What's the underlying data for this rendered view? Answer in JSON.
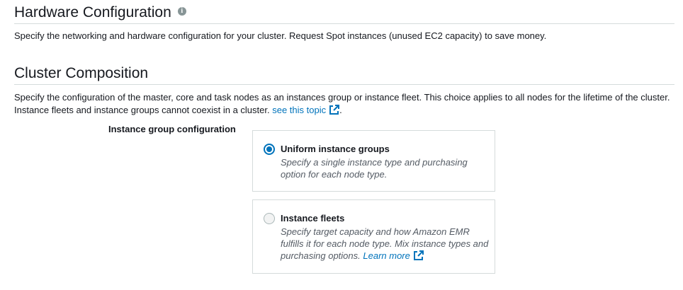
{
  "hardware": {
    "title": "Hardware Configuration",
    "info_icon": "info-icon",
    "description": "Specify the networking and hardware configuration for your cluster. Request Spot instances (unused EC2 capacity) to save money."
  },
  "composition": {
    "title": "Cluster Composition",
    "description": "Specify the configuration of the master, core and task nodes as an instances group or instance fleet. This choice applies to all nodes for the lifetime of the cluster. Instance fleets and instance groups cannot coexist in a cluster.",
    "link_text": "see this topic",
    "link_icon": "external-link-icon",
    "trailing": "."
  },
  "instance_config": {
    "label": "Instance group configuration",
    "selected": "uniform",
    "options": [
      {
        "id": "uniform",
        "title": "Uniform instance groups",
        "description": "Specify a single instance type and purchasing option for each node type."
      },
      {
        "id": "fleets",
        "title": "Instance fleets",
        "description": "Specify target capacity and how Amazon EMR fulfills it for each node type. Mix instance types and purchasing options.",
        "link_text": "Learn more",
        "link_icon": "external-link-icon"
      }
    ]
  },
  "colors": {
    "link": "#0073bb",
    "radio_selected": "#0073bb",
    "border": "#d5dbdb",
    "muted_text": "#545b64"
  }
}
